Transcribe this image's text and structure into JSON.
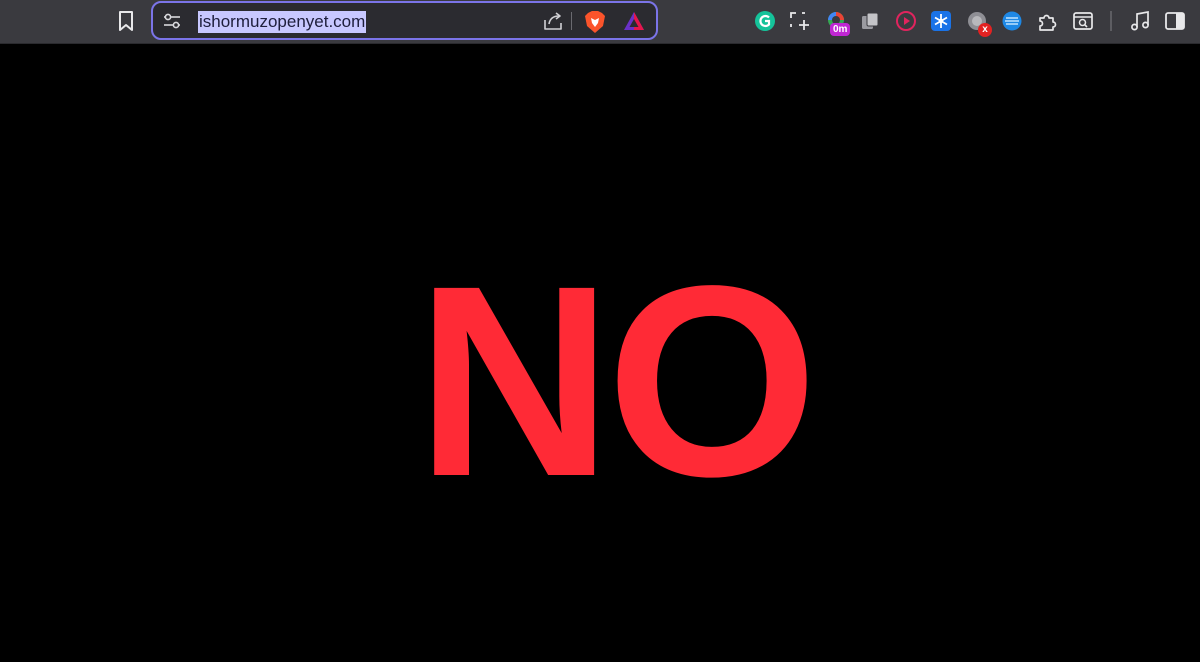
{
  "address_bar": {
    "url": "ishormuzopenyet.com"
  },
  "extensions": {
    "timer_badge": "0m",
    "error_badge": "x"
  },
  "icons": [
    "bookmark-icon",
    "site-settings-icon",
    "share-icon",
    "brave-shields-icon",
    "brave-rewards-icon",
    "grammarly-icon",
    "screenshot-icon",
    "timer-extension-icon",
    "copy-extension-icon",
    "media-extension-icon",
    "snowflake-extension-icon",
    "disabled-extension-icon",
    "vpn-extension-icon",
    "extensions-puzzle-icon",
    "tab-search-icon",
    "media-controls-icon",
    "sidebar-toggle-icon"
  ],
  "page": {
    "headline": "NO",
    "background_color": "#000000",
    "headline_color": "#ff2a36"
  }
}
